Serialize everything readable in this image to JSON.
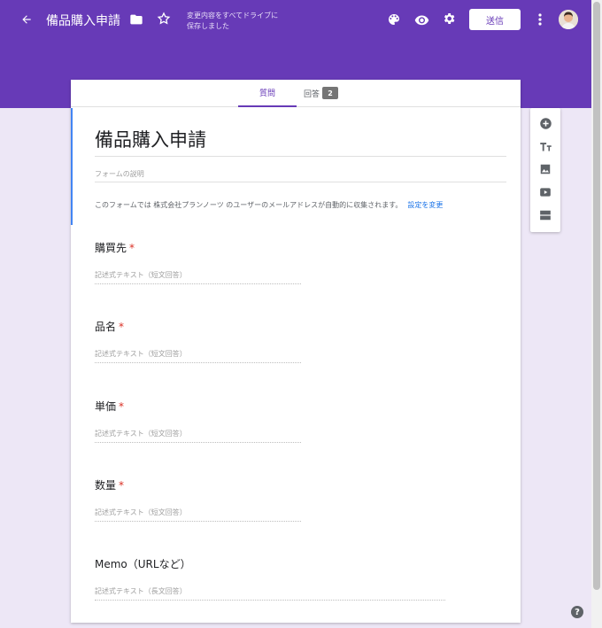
{
  "header": {
    "title": "備品購入申請",
    "saved_line1": "変更内容をすべてドライブに",
    "saved_line2": "保存しました",
    "send_label": "送信"
  },
  "tabs": {
    "questions_label": "質問",
    "responses_label": "回答",
    "responses_count": "2"
  },
  "form": {
    "title": "備品購入申請",
    "description_placeholder": "フォームの説明",
    "notice": "このフォームでは 株式会社プランノーツ のユーザーのメールアドレスが自動的に収集されます。",
    "notice_link": "設定を変更"
  },
  "questions": [
    {
      "label": "購買先",
      "required_mark": "*",
      "placeholder": "記述式テキスト（短文回答）"
    },
    {
      "label": "品名",
      "required_mark": "*",
      "placeholder": "記述式テキスト（短文回答）"
    },
    {
      "label": "単価",
      "required_mark": "*",
      "placeholder": "記述式テキスト（短文回答）"
    },
    {
      "label": "数量",
      "required_mark": "*",
      "placeholder": "記述式テキスト（短文回答）"
    },
    {
      "label": "Memo（URLなど）",
      "placeholder": "記述式テキスト（長文回答）"
    }
  ],
  "toolbar_icons": [
    "add-question-icon",
    "add-title-icon",
    "add-image-icon",
    "add-video-icon",
    "add-section-icon"
  ],
  "help_label": "?",
  "colors": {
    "header": "#673ab7",
    "background": "#ede7f6",
    "accent": "#4285f4",
    "required": "#d93025",
    "link": "#1a73e8"
  }
}
